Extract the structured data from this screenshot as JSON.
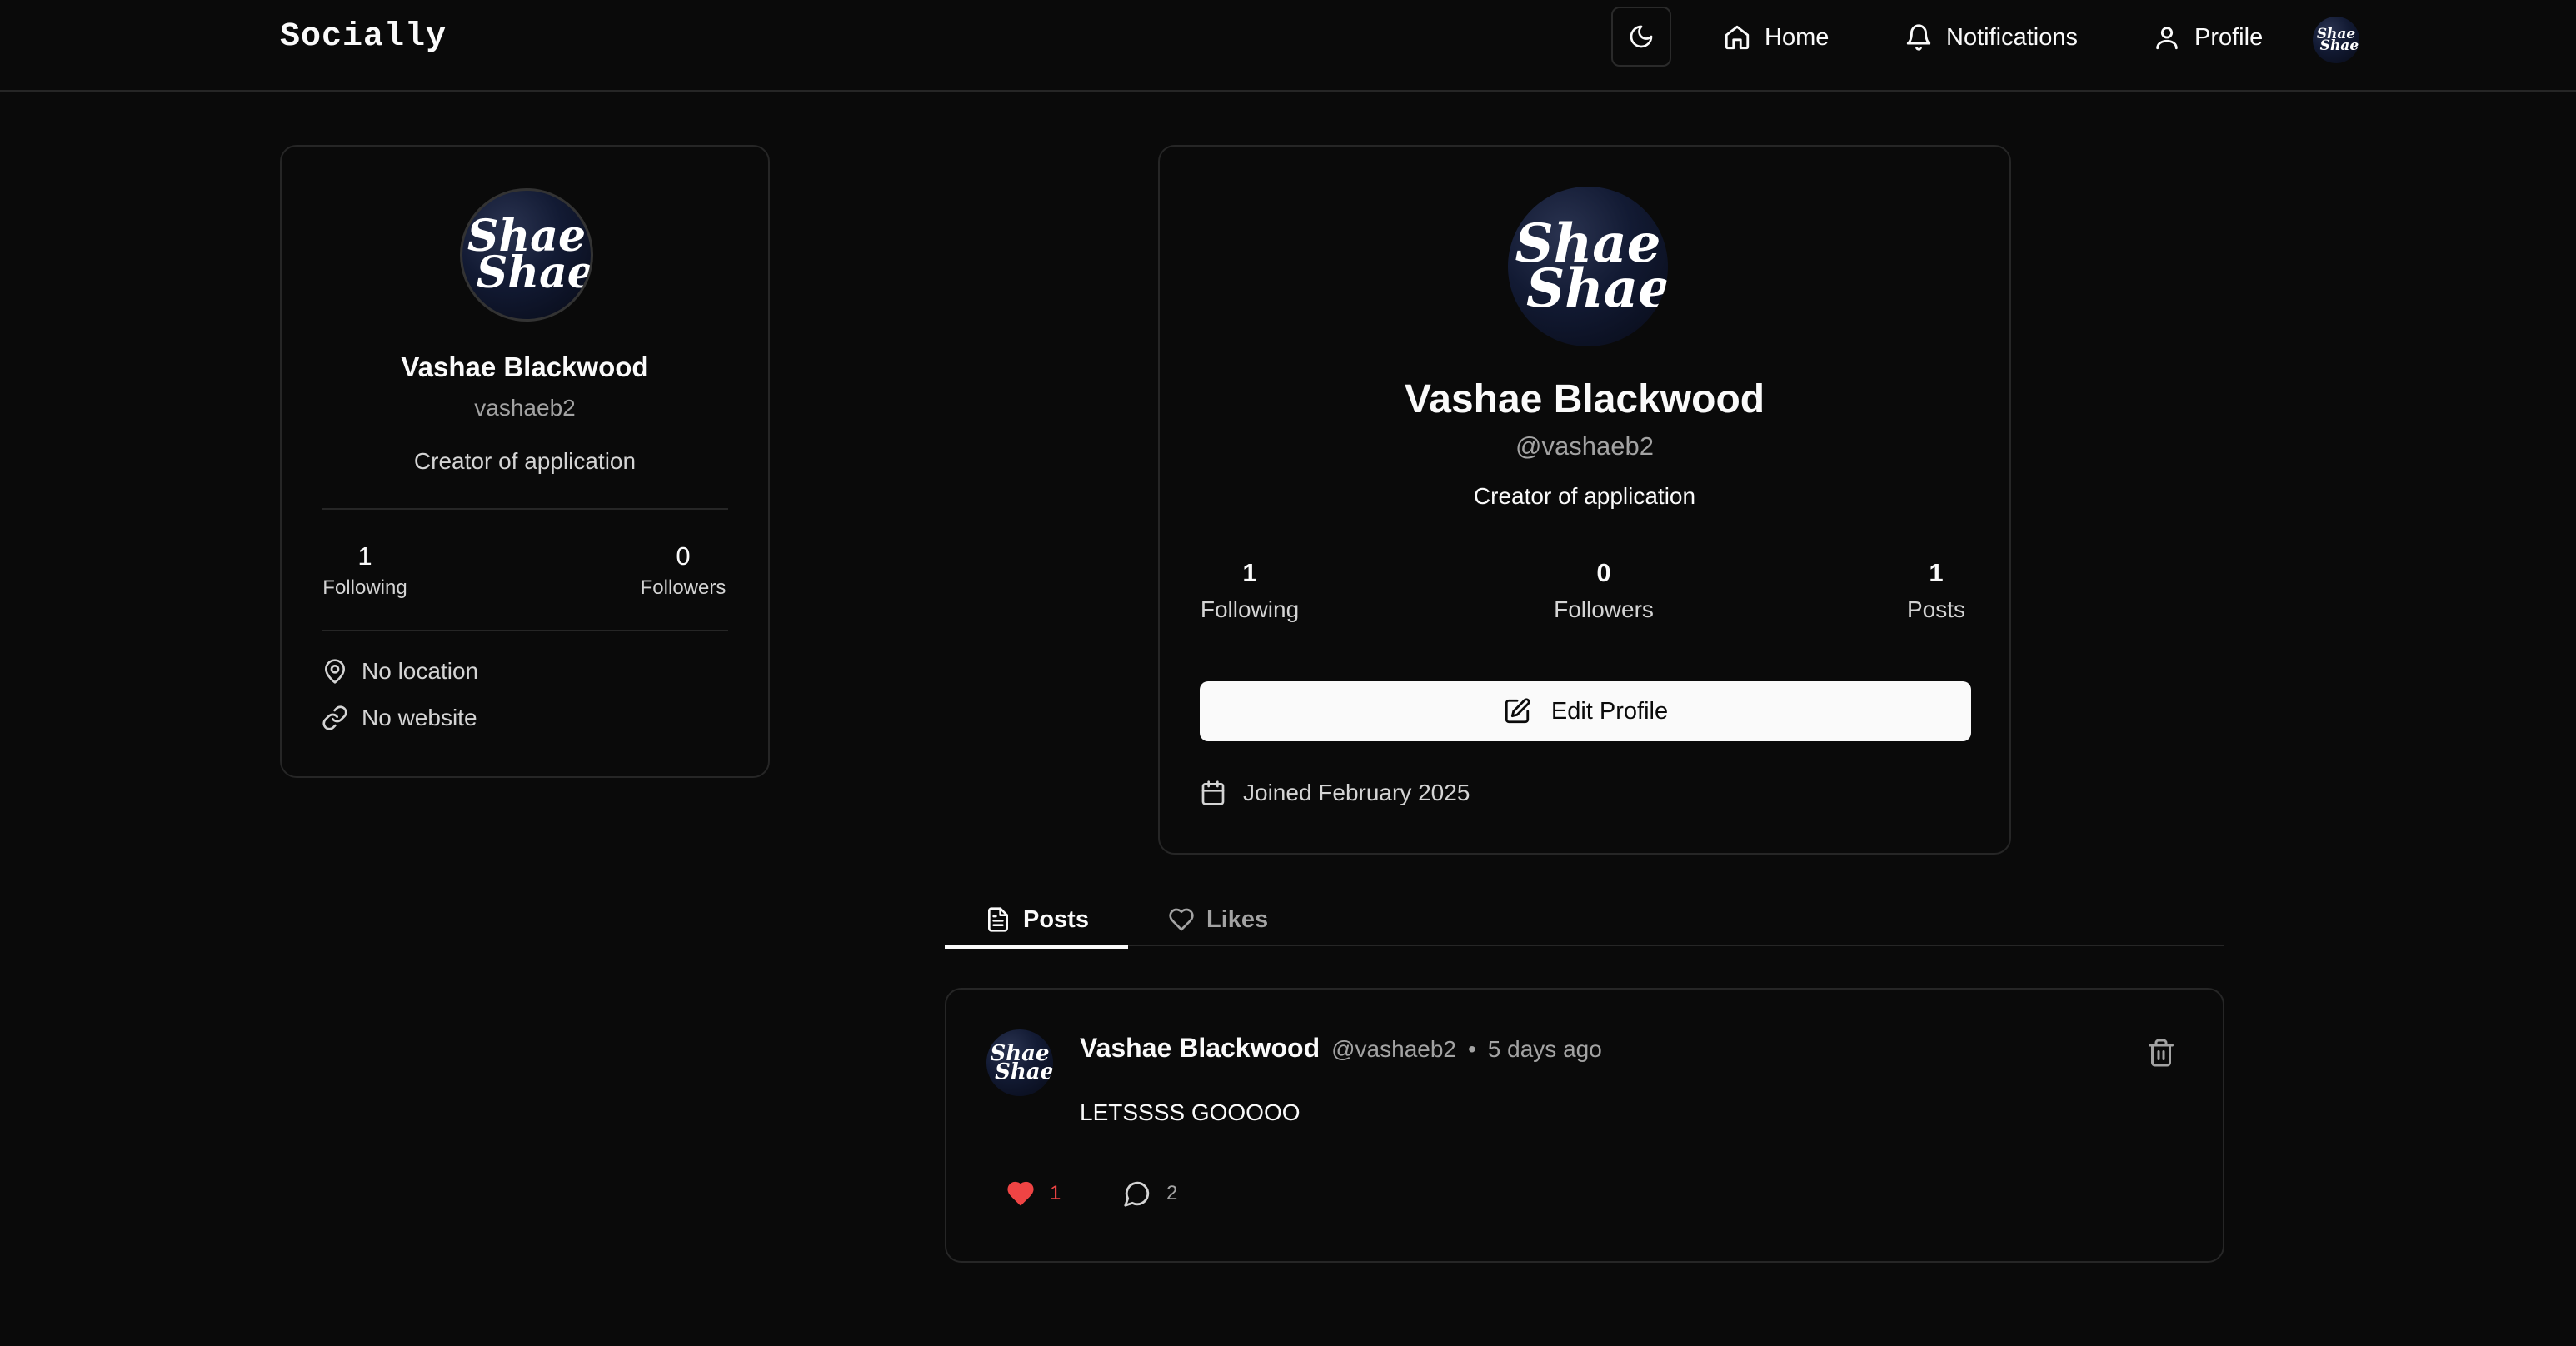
{
  "app": {
    "brand": "Socially"
  },
  "nav": {
    "home": "Home",
    "notifications": "Notifications",
    "profile": "Profile"
  },
  "avatar": {
    "line1": "Shae",
    "line2": "Shae"
  },
  "sidebar": {
    "name": "Vashae Blackwood",
    "username": "vashaeb2",
    "bio": "Creator of application",
    "following_count": "1",
    "following_label": "Following",
    "followers_count": "0",
    "followers_label": "Followers",
    "location": "No location",
    "website": "No website"
  },
  "profile": {
    "name": "Vashae Blackwood",
    "handle": "@vashaeb2",
    "bio": "Creator of application",
    "following_count": "1",
    "following_label": "Following",
    "followers_count": "0",
    "followers_label": "Followers",
    "posts_count": "1",
    "posts_label": "Posts",
    "edit_label": "Edit Profile",
    "joined": "Joined February 2025"
  },
  "tabs": {
    "posts": "Posts",
    "likes": "Likes"
  },
  "post": {
    "author": "Vashae Blackwood",
    "handle": "@vashaeb2",
    "separator": "•",
    "time": "5 days ago",
    "content": "LETSSSS GOOOOO",
    "likes": "1",
    "comments": "2"
  },
  "colors": {
    "background": "#0a0a0a",
    "border": "#262626",
    "like": "#ef4444",
    "button": "#fafafa"
  },
  "icons": [
    "moon-icon",
    "home-icon",
    "bell-icon",
    "user-icon",
    "map-pin-icon",
    "link-icon",
    "edit-icon",
    "calendar-icon",
    "file-text-icon",
    "heart-icon",
    "trash-icon",
    "message-circle-icon"
  ]
}
